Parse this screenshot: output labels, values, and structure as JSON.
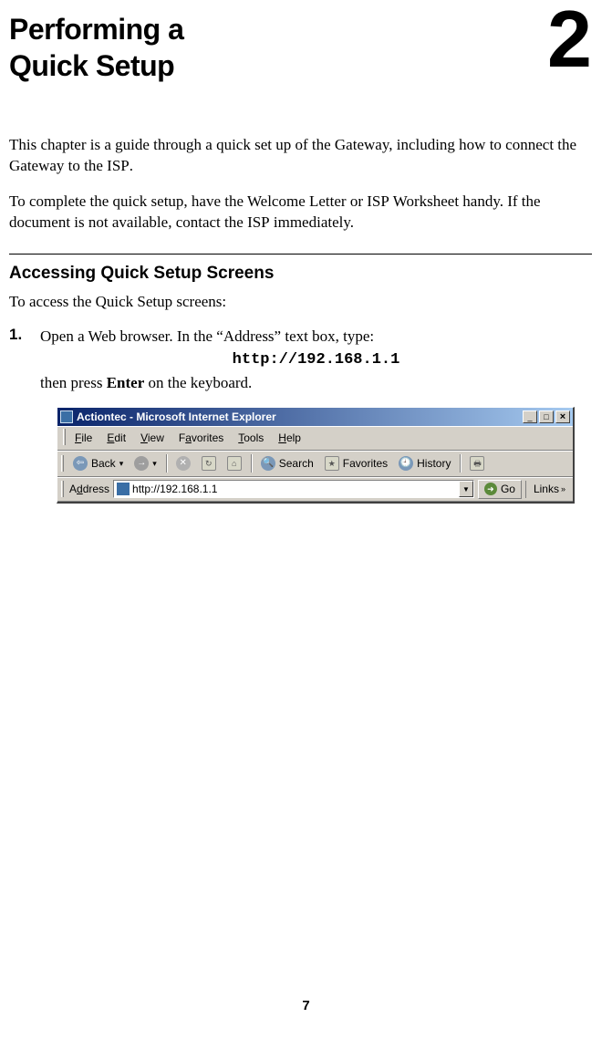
{
  "header": {
    "title_line1": "Performing a",
    "title_line2": "Quick Setup",
    "chapter_number": "2"
  },
  "paragraphs": {
    "intro1_a": "This chapter is a guide through a quick set up of the Gateway, including how to connect the Gateway to the ",
    "intro1_isp": "ISP",
    "intro1_b": ".",
    "intro2_a": "To complete the quick setup, have the Welcome Letter or ",
    "intro2_isp1": "ISP",
    "intro2_b": " Worksheet handy. If the document is not available, contact the ",
    "intro2_isp2": "ISP",
    "intro2_c": " immediately."
  },
  "section": {
    "heading": "Accessing Quick Setup Screens",
    "lead": "To access the Quick Setup screens:"
  },
  "step1": {
    "num": "1.",
    "line1": "Open a Web browser. In the “Address” text box, type:",
    "code": "http://192.168.1.1",
    "line2_a": "then press ",
    "enter": "Enter",
    "line2_b": " on the keyboard."
  },
  "browser": {
    "title": "Actiontec - Microsoft Internet Explorer",
    "menu": {
      "file": "File",
      "edit": "Edit",
      "view": "View",
      "favorites": "Favorites",
      "tools": "Tools",
      "help": "Help"
    },
    "toolbar": {
      "back": "Back",
      "search": "Search",
      "favorites": "Favorites",
      "history": "History"
    },
    "address_label": "Address",
    "address_value": "http://192.168.1.1",
    "go": "Go",
    "links": "Links"
  },
  "page_number": "7"
}
